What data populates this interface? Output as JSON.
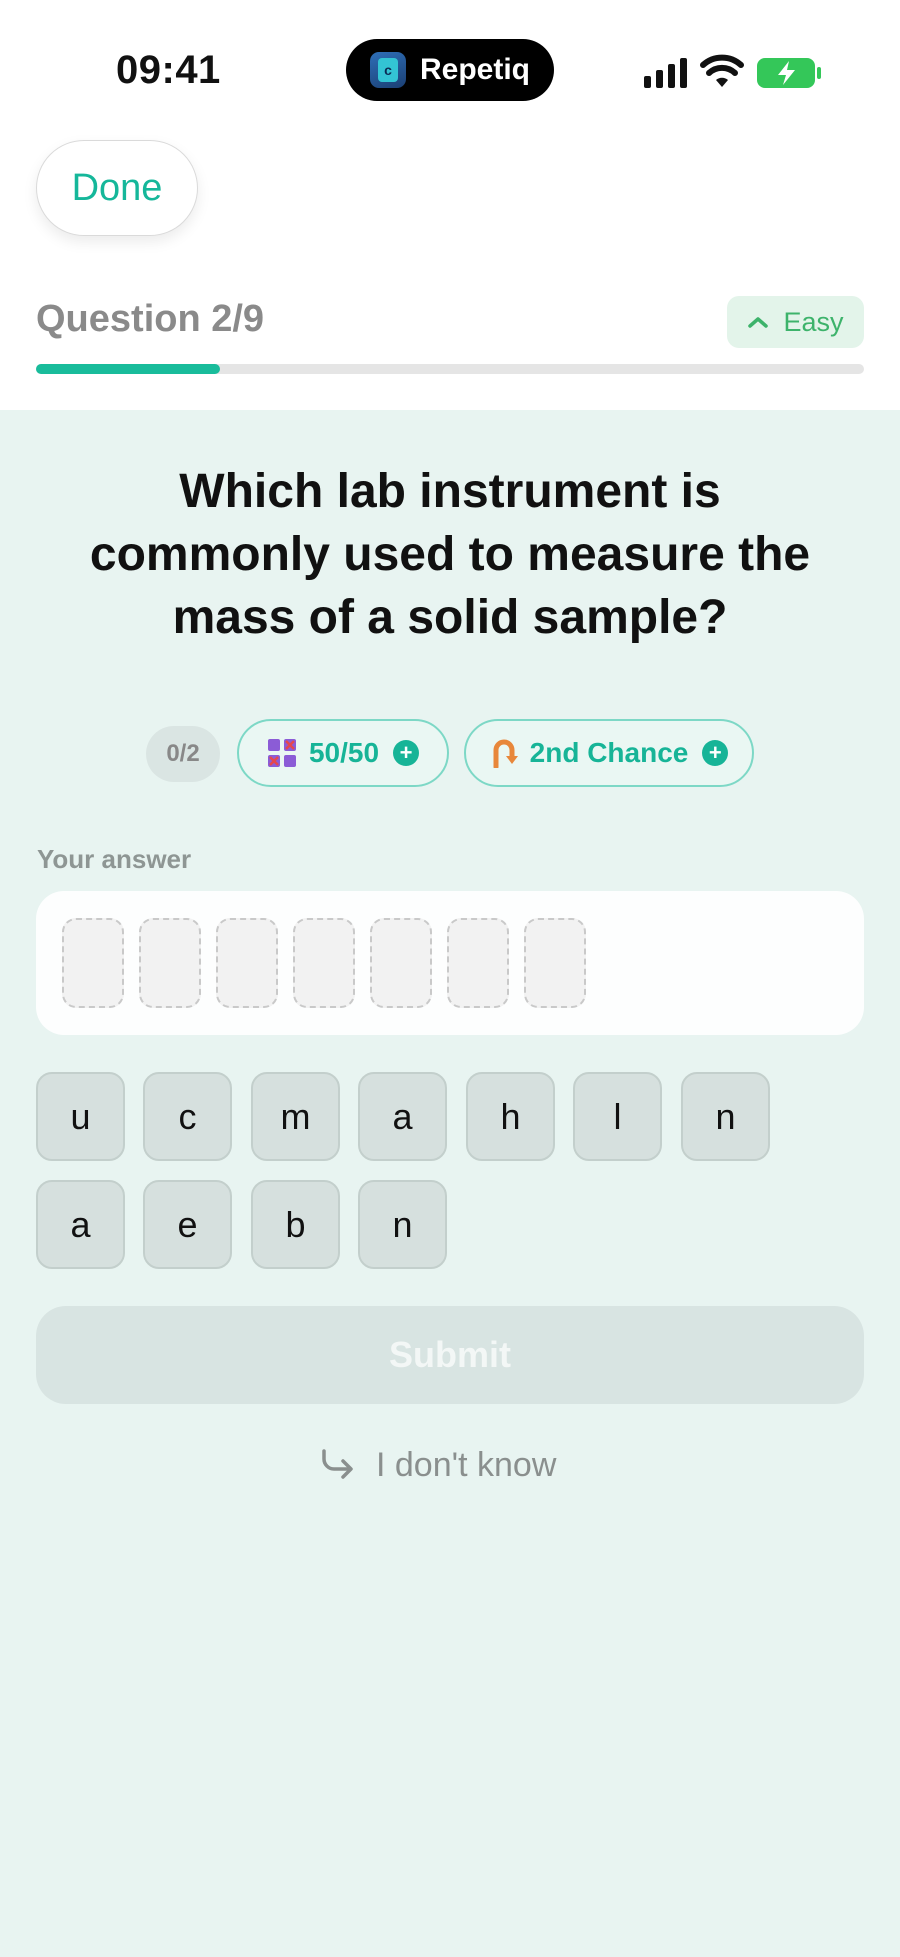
{
  "status_bar": {
    "time": "09:41",
    "island_app_name": "Repetiq",
    "island_icon": "repetiq-app-icon"
  },
  "header": {
    "done_label": "Done",
    "question_counter": "Question 2/9",
    "difficulty_label": "Easy",
    "difficulty_icon": "chevron-up-icon",
    "progress_fraction": 0.222,
    "accent_color": "#19BC9B"
  },
  "question": {
    "text": "Which lab instrument is commonly used to measure the mass of a solid sample?"
  },
  "powerups": {
    "count": "0/2",
    "fifty_fifty_label": "50/50",
    "second_chance_label": "2nd Chance"
  },
  "answer": {
    "label": "Your answer",
    "slot_count": 7
  },
  "letters": [
    "u",
    "c",
    "m",
    "a",
    "h",
    "l",
    "n",
    "a",
    "e",
    "b",
    "n"
  ],
  "actions": {
    "submit_label": "Submit",
    "idk_label": "I don't know"
  }
}
